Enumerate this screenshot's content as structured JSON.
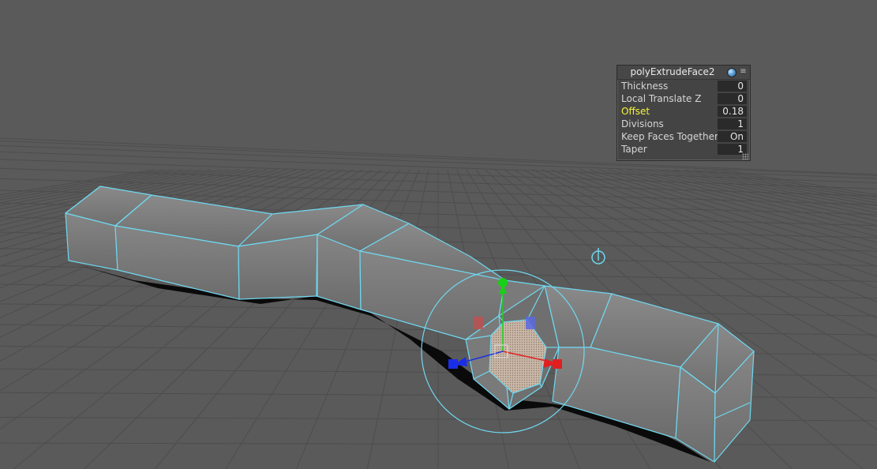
{
  "channel_box": {
    "title": "polyExtrudeFace2",
    "rows": [
      {
        "label": "Thickness",
        "value": "0",
        "active": false
      },
      {
        "label": "Local Translate Z",
        "value": "0",
        "active": false
      },
      {
        "label": "Offset",
        "value": "0.18",
        "active": true
      },
      {
        "label": "Divisions",
        "value": "1",
        "active": false
      },
      {
        "label": "Keep Faces Together",
        "value": "On",
        "active": false
      },
      {
        "label": "Taper",
        "value": "1",
        "active": false
      }
    ]
  },
  "viewport": {
    "background": "#5a5a5a",
    "grid_color": "#4a4a4a",
    "wire_color": "#6fd8f0",
    "highlight_color": "#f5f53c",
    "manipulator_colors": {
      "x": "#e02020",
      "y": "#18d018",
      "z": "#1a2ee8"
    }
  }
}
